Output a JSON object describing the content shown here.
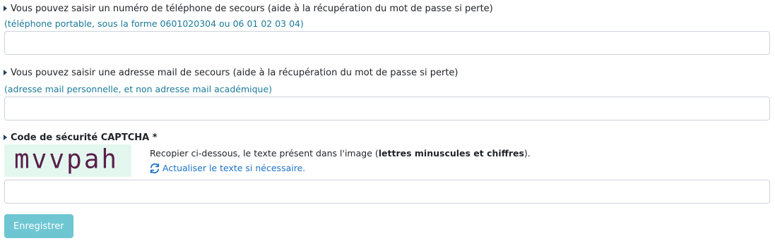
{
  "phone_section": {
    "label": "Vous pouvez saisir un numéro de téléphone de secours (aide à la récupération du mot de passe si perte)",
    "hint": "(téléphone portable, sous la forme 0601020304 ou 06 01 02 03 04)",
    "value": ""
  },
  "email_section": {
    "label": "Vous pouvez saisir une adresse mail de secours (aide à la récupération du mot de passe si perte)",
    "hint": "(adresse mail personnelle, et non adresse mail académique)",
    "value": ""
  },
  "captcha_section": {
    "label": "Code de sécurité CAPTCHA *",
    "image_text": "mvvpah",
    "instruction_prefix": "Recopier ci-dessous, le texte présent dans l'image (",
    "instruction_bold": "lettres minuscules et chiffres",
    "instruction_suffix": ").",
    "refresh_label": "Actualiser le texte si nécessaire.",
    "value": ""
  },
  "actions": {
    "submit_label": "Enregistrer"
  },
  "colors": {
    "hint": "#1a7a9a",
    "link": "#1a73c9",
    "button": "#6ec6d3",
    "captcha_bg": "#e3f7ef",
    "captcha_text": "#5a1f4a"
  },
  "icons": {
    "caret": "caret-right-icon",
    "refresh": "refresh-icon"
  }
}
